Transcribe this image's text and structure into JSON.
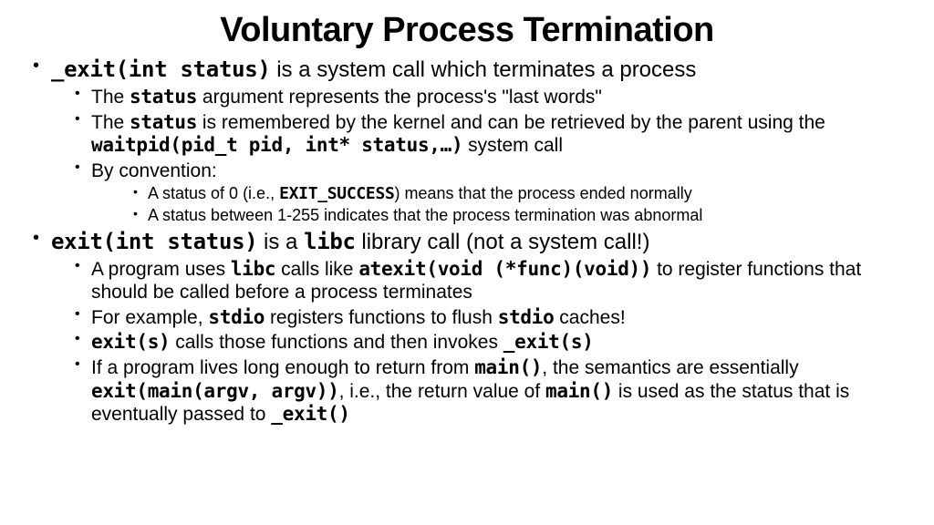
{
  "title": "Voluntary Process Termination",
  "b1": {
    "code": "_exit(int status)",
    "rest": " is a system call which terminates a process",
    "sub": {
      "s1": {
        "pre": "The ",
        "code": "status",
        "post": " argument represents the process's \"last words\""
      },
      "s2": {
        "pre": "The ",
        "c1": "status",
        "mid": " is remembered by the kernel and can be retrieved by the parent using the ",
        "c2": "waitpid(pid_t pid, int* status,…)",
        "post": " system call"
      },
      "s3": {
        "text": "By convention:"
      },
      "s3a": {
        "pre": "A status of 0 (i.e., ",
        "code": "EXIT_SUCCESS",
        "post": ") means that the process ended normally"
      },
      "s3b": {
        "text": "A status between 1-255 indicates that the process termination was abnormal"
      }
    }
  },
  "b2": {
    "c1": "exit(int status)",
    "mid": " is a ",
    "c2": "libc",
    "rest": " library call (not a system call!)",
    "sub": {
      "s1": {
        "pre": "A program uses ",
        "c1": "libc",
        "mid": " calls like ",
        "c2": "atexit(void (*func)(void))",
        "post": " to register functions that should be called before a process terminates"
      },
      "s2": {
        "pre": "For example, ",
        "c1": "stdio",
        "mid": " registers functions to flush ",
        "c2": "stdio",
        "post": " caches!"
      },
      "s3": {
        "c1": "exit(s)",
        "mid": " calls those functions and then invokes ",
        "c2": "_exit(s)"
      },
      "s4": {
        "pre": "If a program lives long enough to return from ",
        "c1": "main()",
        "mid1": ", the semantics are essentially ",
        "c2": "exit(main(argv, argv))",
        "mid2": ", i.e., the return value of ",
        "c3": "main()",
        "mid3": " is used as the status that is eventually passed to ",
        "c4": "_exit()"
      }
    }
  }
}
